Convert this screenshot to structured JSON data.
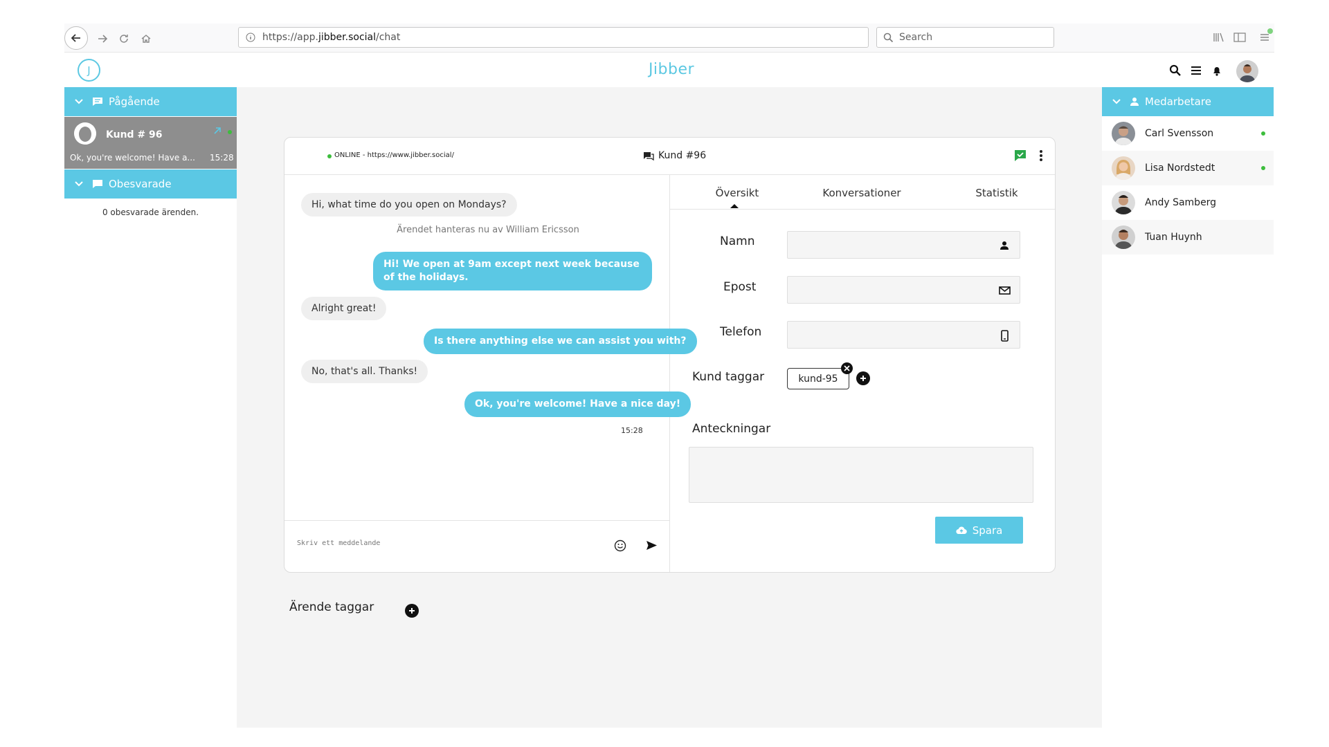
{
  "browser": {
    "url_prefix": "https://app.",
    "url_domain": "jibber.social",
    "url_path": "/chat",
    "search_placeholder": "Search"
  },
  "app": {
    "logo_letter": "J",
    "title": "Jibber"
  },
  "left_sidebar": {
    "ongoing_label": "Pågående",
    "conversation": {
      "name": "Kund # 96",
      "preview": "Ok, you're welcome! Have a...",
      "time": "15:28"
    },
    "unanswered_label": "Obesvarade",
    "unanswered_empty": "0 obesvarade ärenden."
  },
  "chat": {
    "status": "ONLINE",
    "status_url": "https://www.jibber.social/",
    "customer_title": "Kund #96",
    "messages": [
      {
        "dir": "in",
        "text": "Hi, what time do you open on Mondays?"
      },
      {
        "dir": "system",
        "text": "Ärendet hanteras nu av William Ericsson"
      },
      {
        "dir": "out",
        "text": "Hi! We open at 9am except next week because of the holidays."
      },
      {
        "dir": "in",
        "text": "Alright great!"
      },
      {
        "dir": "out",
        "text": "Is there anything else we can assist you with?"
      },
      {
        "dir": "in",
        "text": "No, that's all. Thanks!"
      },
      {
        "dir": "out",
        "text": "Ok, you're welcome! Have a nice day!"
      }
    ],
    "last_time": "15:28",
    "compose_placeholder": "Skriv ett meddelande"
  },
  "customer_panel": {
    "tabs": [
      "Översikt",
      "Konversationer",
      "Statistik"
    ],
    "active_tab": "Översikt",
    "fields": {
      "name_label": "Namn",
      "email_label": "Epost",
      "phone_label": "Telefon",
      "tags_label": "Kund taggar",
      "notes_label": "Anteckningar"
    },
    "tag": "kund-95",
    "save_label": "Spara"
  },
  "case_tags_label": "Ärende taggar",
  "right_sidebar": {
    "title": "Medarbetare",
    "coworkers": [
      {
        "name": "Carl Svensson",
        "online": true
      },
      {
        "name": "Lisa Nordstedt",
        "online": true
      },
      {
        "name": "Andy Samberg",
        "online": false
      },
      {
        "name": "Tuan Huynh",
        "online": false
      }
    ]
  },
  "colors": {
    "accent": "#5bc8e4",
    "online": "#3dbd3d",
    "selected_conversation": "#8e8e8e",
    "background": "#f4f4f4"
  }
}
